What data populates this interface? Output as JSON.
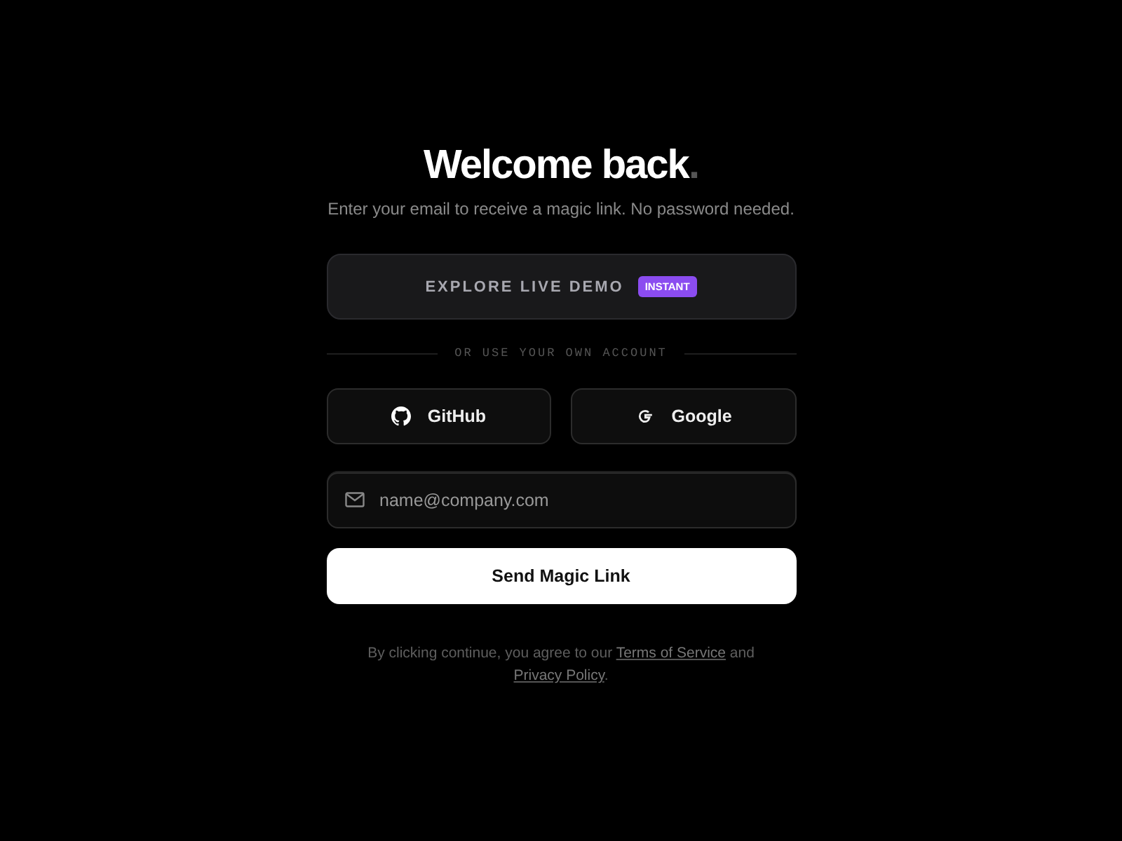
{
  "heading": {
    "title": "Welcome back",
    "mark": "."
  },
  "subtitle": "Enter your email to receive a magic link. No password needed.",
  "demo_button": {
    "label": "EXPLORE LIVE DEMO",
    "badge": "INSTANT"
  },
  "divider": "OR USE YOUR OWN ACCOUNT",
  "providers": [
    {
      "kind": "github",
      "label": "GitHub"
    },
    {
      "kind": "google",
      "label": "Google"
    }
  ],
  "email_field": {
    "placeholder": "name@company.com"
  },
  "submit_button": "Send Magic Link",
  "legal": [
    {
      "kind": "text",
      "text": "By clicking continue, you agree to our "
    },
    {
      "kind": "link",
      "text": "Terms of Service"
    },
    {
      "kind": "text",
      "text": " and "
    },
    {
      "kind": "link",
      "text": "Privacy Policy"
    },
    {
      "kind": "text",
      "text": "."
    }
  ]
}
